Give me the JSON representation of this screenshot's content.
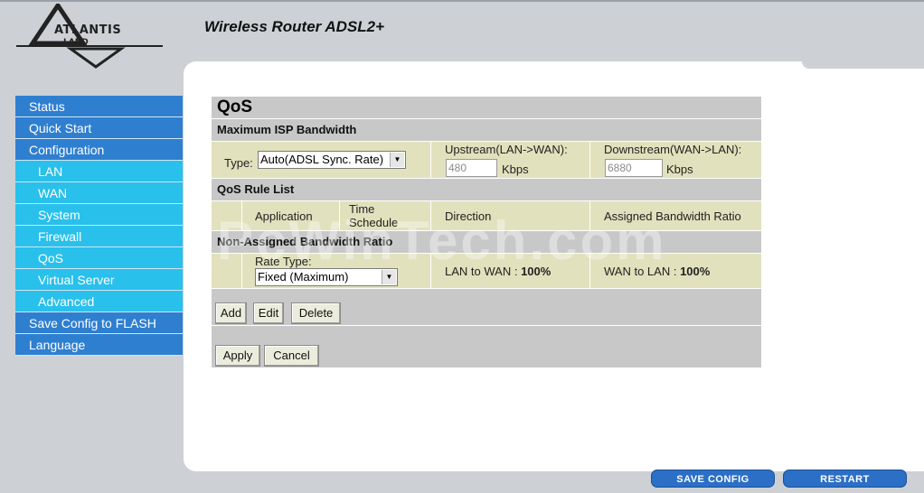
{
  "header": {
    "logo_text": "ATLANTIS",
    "logo_sub": "LAND",
    "title": "Wireless Router ADSL2+"
  },
  "sidebar": {
    "items": [
      {
        "label": "Status",
        "level": "main"
      },
      {
        "label": "Quick Start",
        "level": "main"
      },
      {
        "label": "Configuration",
        "level": "main"
      },
      {
        "label": "LAN",
        "level": "sub"
      },
      {
        "label": "WAN",
        "level": "sub"
      },
      {
        "label": "System",
        "level": "sub"
      },
      {
        "label": "Firewall",
        "level": "sub"
      },
      {
        "label": "QoS",
        "level": "sub"
      },
      {
        "label": "Virtual Server",
        "level": "sub"
      },
      {
        "label": "Advanced",
        "level": "sub"
      },
      {
        "label": "Save Config to FLASH",
        "level": "main"
      },
      {
        "label": "Language",
        "level": "main"
      }
    ]
  },
  "qos": {
    "title": "QoS",
    "max_isp_bandwidth": {
      "heading": "Maximum ISP Bandwidth",
      "type_label": "Type:",
      "type_value": "Auto(ADSL Sync. Rate)",
      "upstream_label": "Upstream(LAN->WAN):",
      "upstream_value": "480",
      "upstream_unit": "Kbps",
      "downstream_label": "Downstream(WAN->LAN):",
      "downstream_value": "6880",
      "downstream_unit": "Kbps"
    },
    "rule_list": {
      "heading": "QoS Rule List",
      "columns": [
        "Application",
        "Time\nSchedule",
        "Direction",
        "Assigned Bandwidth Ratio"
      ]
    },
    "non_assigned": {
      "heading": "Non-Assigned Bandwidth Ratio",
      "rate_type_label": "Rate Type:",
      "rate_type_value": "Fixed (Maximum)",
      "lan_to_wan_label": "LAN to WAN :",
      "lan_to_wan_value": "100%",
      "wan_to_lan_label": "WAN to LAN :",
      "wan_to_lan_value": "100%"
    },
    "buttons": {
      "add": "Add",
      "edit": "Edit",
      "delete": "Delete",
      "apply": "Apply",
      "cancel": "Cancel"
    }
  },
  "watermark": "PcWinTech.com",
  "footer": {
    "save_config": "SAVE CONFIG",
    "restart": "RESTART"
  },
  "colors": {
    "nav_main": "#2f7fd1",
    "nav_sub": "#29c0ec",
    "section_bg": "#c8c8c8",
    "row_bg": "#e1e1bd",
    "footer_button": "#2b6fc7"
  }
}
